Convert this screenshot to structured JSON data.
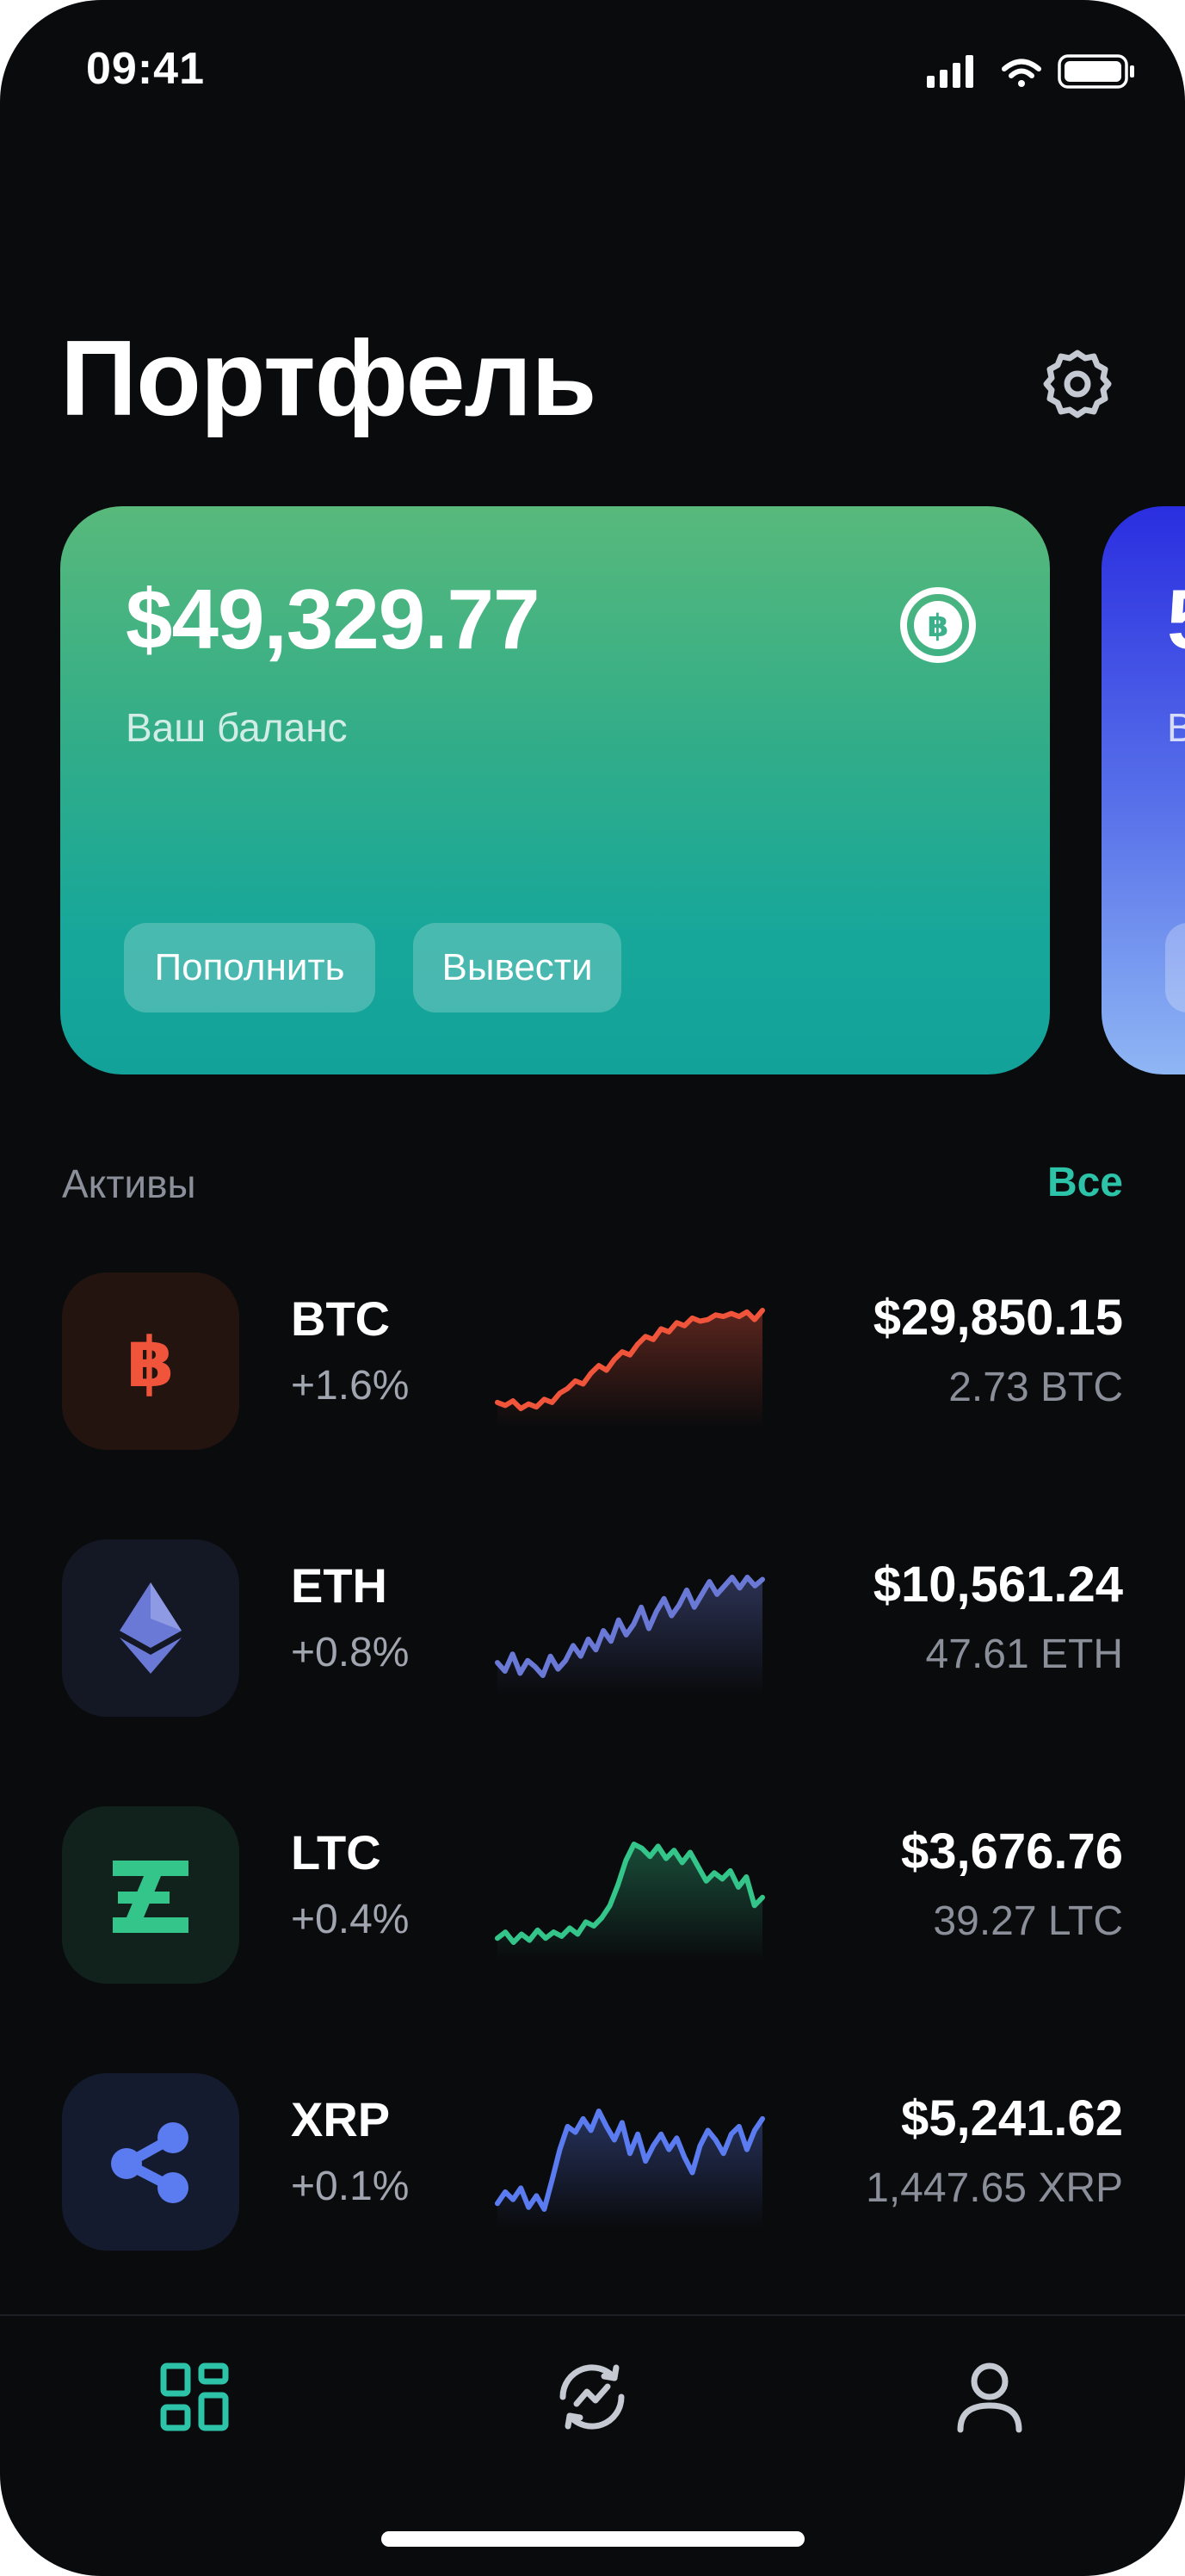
{
  "status_bar": {
    "time": "09:41",
    "icons": [
      "signal-icon",
      "wifi-icon",
      "battery-icon"
    ]
  },
  "header": {
    "title": "Портфель",
    "settings_icon": "gear-icon"
  },
  "balance_card": {
    "amount": "$49,329.77",
    "subtitle": "Ваш баланс",
    "coin_icon": "bitcoin-circle-icon",
    "buttons": {
      "deposit": "Пополнить",
      "withdraw": "Вывести"
    },
    "colors": {
      "top": "#58b97b",
      "bottom": "#12a29a"
    }
  },
  "second_card": {
    "amount_visible": "5",
    "subtitle_visible": "В",
    "colors": {
      "top": "#2a2ee0",
      "bottom": "#8fb6f4"
    }
  },
  "assets": {
    "label": "Активы",
    "all_link": "Все",
    "accent_color": "#2cc3a9",
    "items": [
      {
        "symbol": "BTC",
        "change": "+1.6%",
        "value": "$29,850.15",
        "amount": "2.73 BTC",
        "icon": "bitcoin-icon",
        "color": "#f0553b",
        "icon_bg": "#24140f",
        "trend": [
          14,
          12,
          15,
          10,
          13,
          11,
          16,
          14,
          20,
          23,
          28,
          26,
          33,
          38,
          35,
          42,
          47,
          45,
          52,
          57,
          55,
          62,
          60,
          66,
          64,
          69,
          67,
          68,
          71,
          70,
          72,
          70,
          73,
          68,
          74
        ]
      },
      {
        "symbol": "ETH",
        "change": "+0.8%",
        "value": "$10,561.24",
        "amount": "47.61 ETH",
        "icon": "ethereum-icon",
        "color": "#6a79d6",
        "icon_bg": "#141824",
        "trend": [
          30,
          26,
          34,
          25,
          31,
          28,
          24,
          33,
          27,
          31,
          38,
          33,
          41,
          36,
          45,
          40,
          50,
          43,
          48,
          56,
          46,
          54,
          60,
          52,
          57,
          64,
          56,
          62,
          68,
          62,
          66,
          70,
          65,
          70,
          66,
          69
        ]
      },
      {
        "symbol": "LTC",
        "change": "+0.4%",
        "value": "$3,676.76",
        "amount": "39.27 LTC",
        "icon": "litecoin-icon",
        "color": "#34c58a",
        "icon_bg": "#10221b",
        "trend": [
          20,
          23,
          18,
          22,
          19,
          24,
          20,
          23,
          21,
          25,
          22,
          28,
          26,
          30,
          36,
          46,
          58,
          66,
          64,
          60,
          65,
          59,
          63,
          57,
          62,
          55,
          48,
          52,
          49,
          53,
          45,
          50,
          36,
          40
        ]
      },
      {
        "symbol": "XRP",
        "change": "+0.1%",
        "value": "$5,241.62",
        "amount": "1,447.65 XRP",
        "icon": "ripple-icon",
        "color": "#5b7cf0",
        "icon_bg": "#141b2e",
        "trend": [
          22,
          28,
          24,
          30,
          20,
          26,
          19,
          34,
          50,
          62,
          59,
          66,
          60,
          70,
          62,
          55,
          64,
          48,
          58,
          44,
          52,
          58,
          50,
          56,
          46,
          38,
          52,
          60,
          55,
          48,
          58,
          62,
          50,
          60,
          66
        ]
      }
    ]
  },
  "bottom_nav": [
    {
      "icon": "dashboard-grid-icon",
      "active": true,
      "color": "#2cc3a9"
    },
    {
      "icon": "exchange-chart-icon",
      "active": false,
      "color": "#c4c9d2"
    },
    {
      "icon": "profile-icon",
      "active": false,
      "color": "#c4c9d2"
    }
  ]
}
